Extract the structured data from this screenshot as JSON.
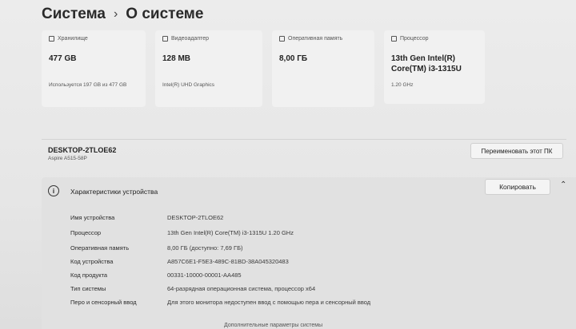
{
  "breadcrumb": {
    "parent": "Система",
    "separator": "›",
    "current": "О системе"
  },
  "cards": [
    {
      "title": "Хранилище",
      "value": "477 GB",
      "sub": "Используется 197 GB из 477 GB"
    },
    {
      "title": "Видеоадаптер",
      "value": "128 MB",
      "sub": "Intel(R) UHD Graphics"
    },
    {
      "title": "Оперативная память",
      "value": "8,00 ГБ",
      "sub": ""
    },
    {
      "title": "Процессор",
      "value": "13th Gen Intel(R) Core(TM) i3-1315U",
      "sub": "1.20 GHz"
    }
  ],
  "device": {
    "name": "DESKTOP-2TLOE62",
    "model": "Aspire A515-58P",
    "rename_button": "Переименовать этот ПК"
  },
  "specs": {
    "title": "Характеристики устройства",
    "copy_button": "Копировать",
    "rows": [
      {
        "label": "Имя устройства",
        "value": "DESKTOP-2TLOE62"
      },
      {
        "label": "Процессор",
        "value": "13th Gen Intel(R) Core(TM) i3-1315U   1.20 GHz"
      },
      {
        "label": "Оперативная память",
        "value": "8,00 ГБ (доступно: 7,69 ГБ)"
      },
      {
        "label": "Код устройства",
        "value": "A857C6E1-F5E3-489C-81BD-38A045320483"
      },
      {
        "label": "Код продукта",
        "value": "00331-10000-00001-AA485"
      },
      {
        "label": "Тип системы",
        "value": "64-разрядная операционная система, процессор x64"
      },
      {
        "label": "Перо и сенсорный ввод",
        "value": "Для этого монитора недоступен ввод с помощью пера и сенсорный ввод"
      }
    ]
  },
  "footer": {
    "link_text": "Дополнительные параметры системы"
  }
}
